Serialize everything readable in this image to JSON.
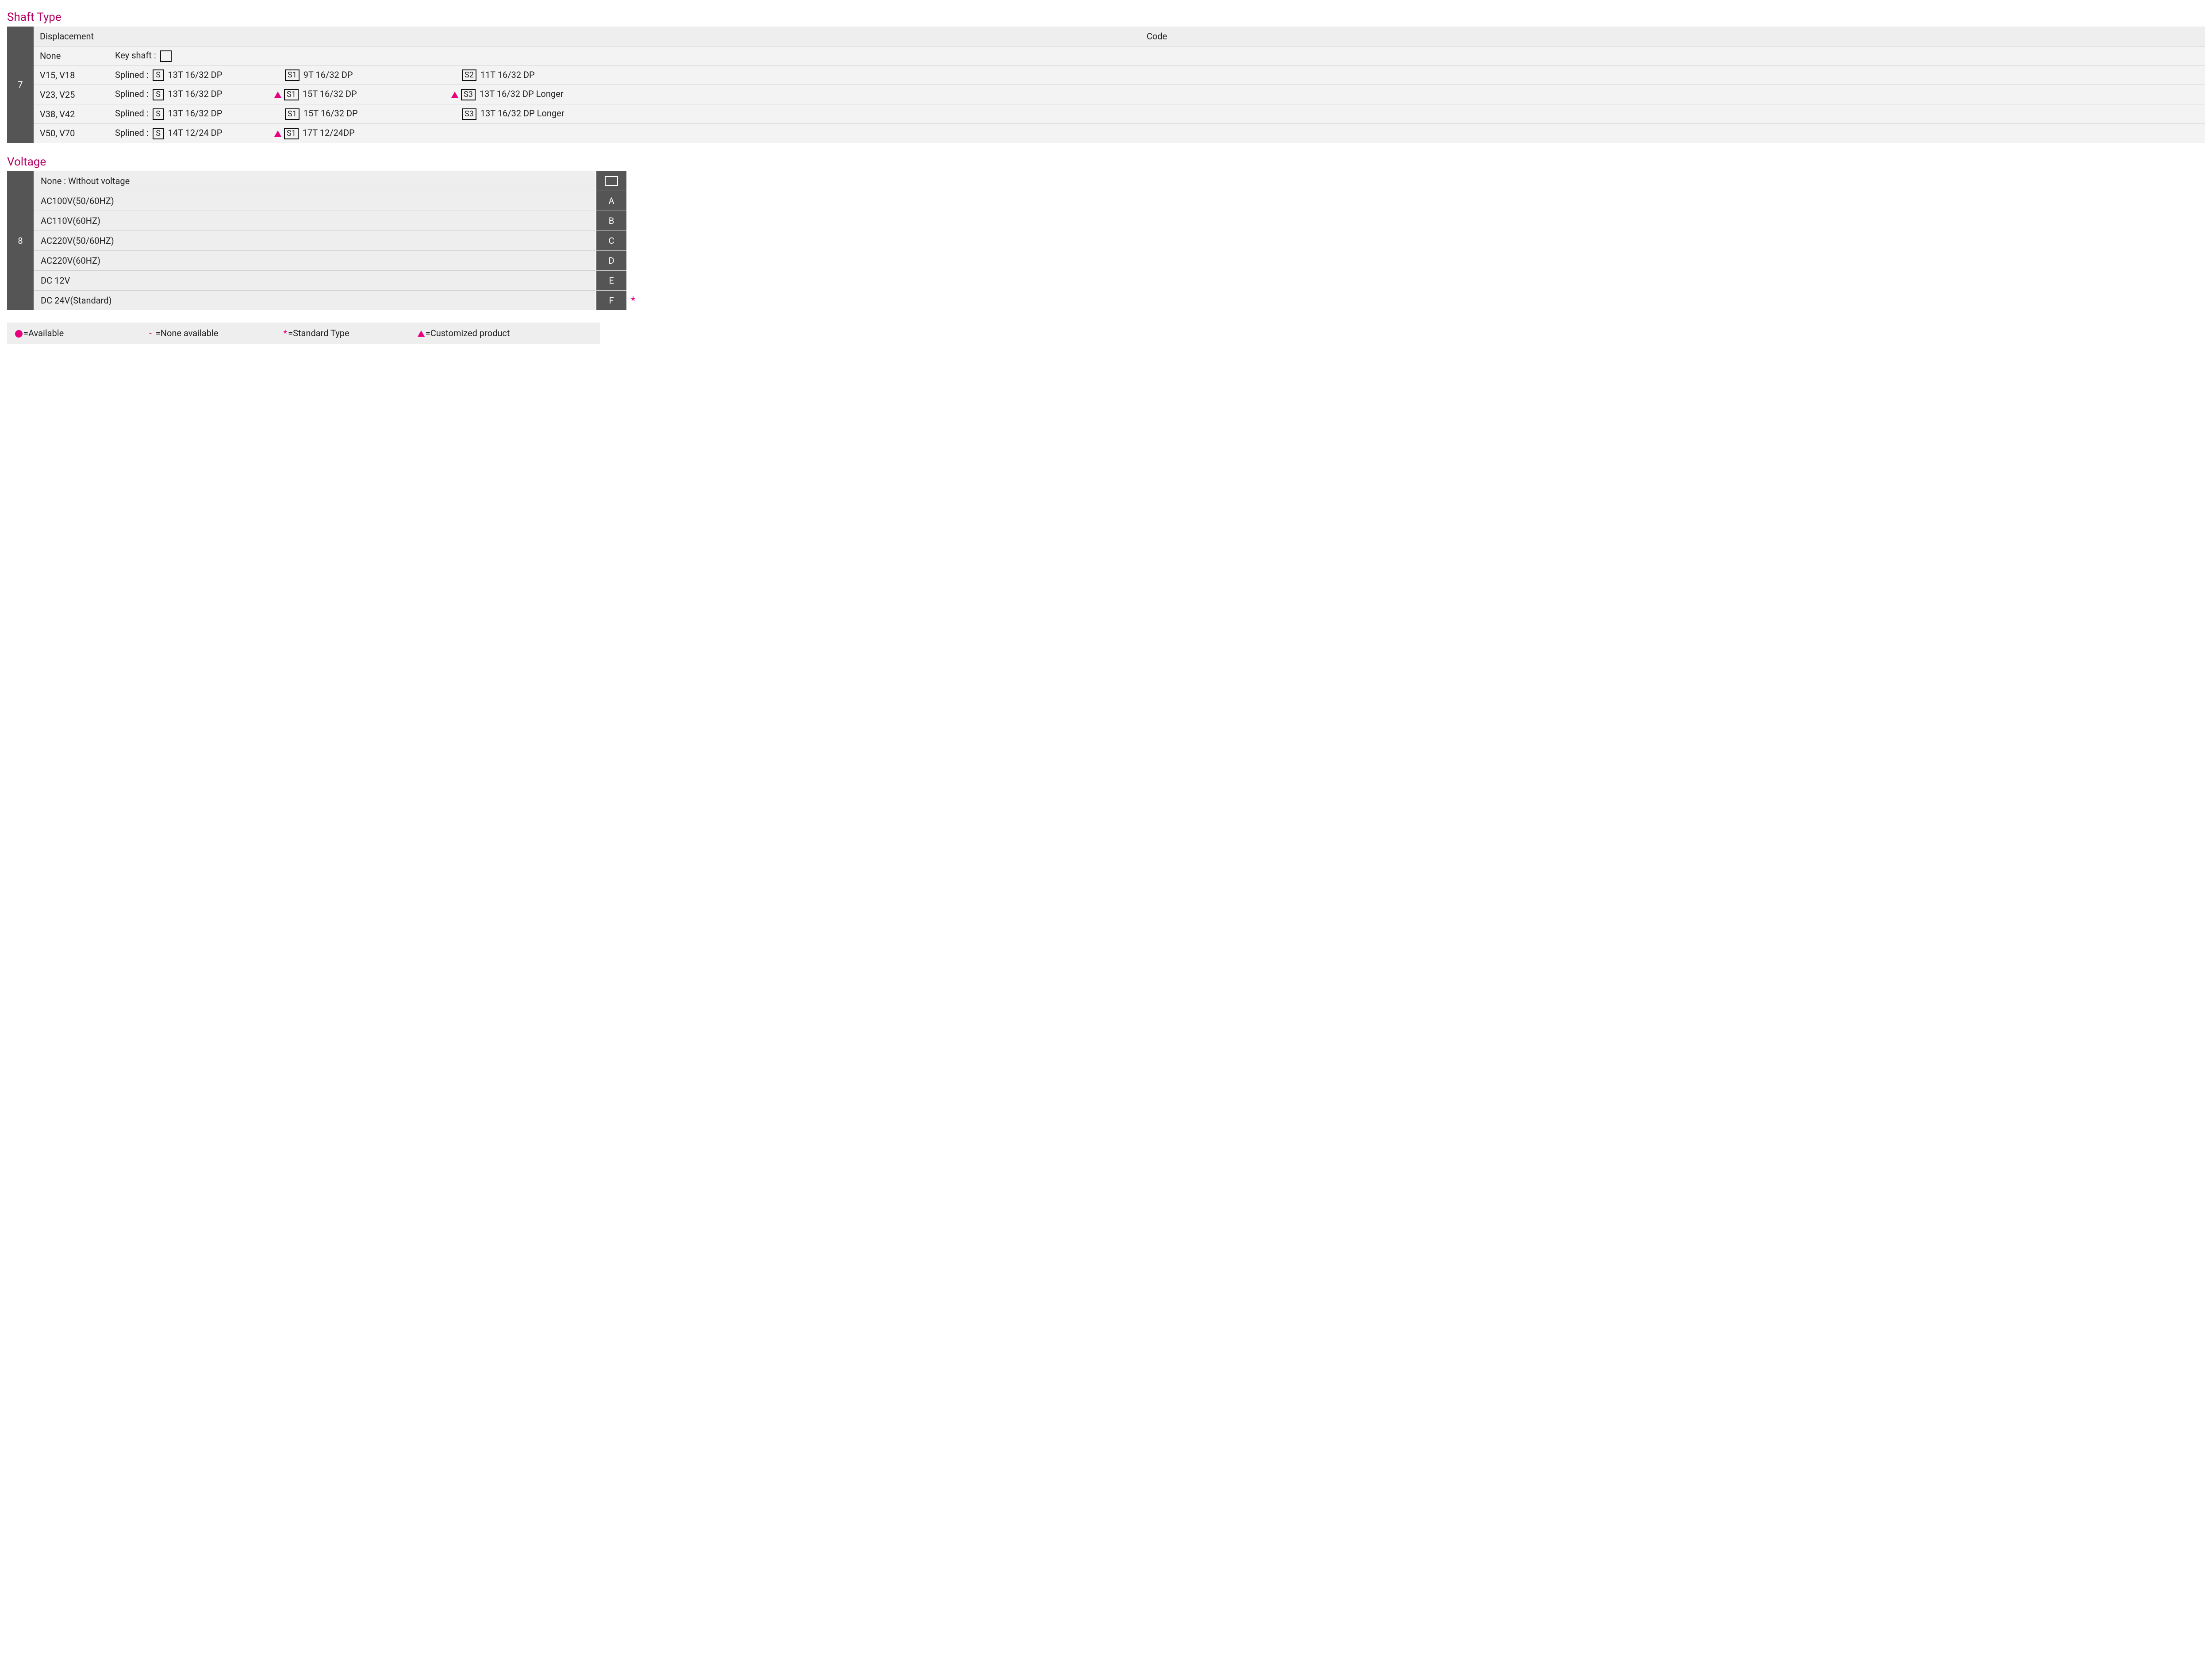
{
  "shaft": {
    "title": "Shaft Type",
    "number": "7",
    "header": {
      "displacement": "Displacement",
      "code": "Code"
    },
    "rows": [
      {
        "displacement": "None",
        "cells": [
          {
            "prefix": "Key shaft :",
            "box": "",
            "suffix": "",
            "tri": false
          }
        ]
      },
      {
        "displacement": "V15, V18",
        "cells": [
          {
            "prefix": "Splined :",
            "box": "S",
            "suffix": "13T 16/32 DP",
            "tri": false
          },
          {
            "prefix": "",
            "box": "S1",
            "suffix": "9T 16/32 DP",
            "tri": false
          },
          {
            "prefix": "",
            "box": "S2",
            "suffix": "11T 16/32 DP",
            "tri": false
          }
        ]
      },
      {
        "displacement": "V23, V25",
        "cells": [
          {
            "prefix": "Splined :",
            "box": "S",
            "suffix": "13T 16/32 DP",
            "tri": false
          },
          {
            "prefix": "",
            "box": "S1",
            "suffix": "15T 16/32 DP",
            "tri": true
          },
          {
            "prefix": "",
            "box": "S3",
            "suffix": "13T 16/32 DP Longer",
            "tri": true
          }
        ]
      },
      {
        "displacement": "V38, V42",
        "cells": [
          {
            "prefix": "Splined :",
            "box": "S",
            "suffix": "13T 16/32 DP",
            "tri": false
          },
          {
            "prefix": "",
            "box": "S1",
            "suffix": "15T 16/32 DP",
            "tri": false
          },
          {
            "prefix": "",
            "box": "S3",
            "suffix": "13T 16/32 DP Longer",
            "tri": false
          }
        ]
      },
      {
        "displacement": "V50, V70",
        "cells": [
          {
            "prefix": "Splined :",
            "box": "S",
            "suffix": "14T 12/24 DP",
            "tri": false
          },
          {
            "prefix": "",
            "box": "S1",
            "suffix": "17T 12/24DP",
            "tri": true
          }
        ]
      }
    ]
  },
  "voltage": {
    "title": "Voltage",
    "number": "8",
    "rows": [
      {
        "label": "None : Without voltage",
        "code": "",
        "star": false
      },
      {
        "label": "AC100V(50/60HZ)",
        "code": "A",
        "star": false
      },
      {
        "label": "AC110V(60HZ)",
        "code": "B",
        "star": false
      },
      {
        "label": "AC220V(50/60HZ)",
        "code": "C",
        "star": false
      },
      {
        "label": "AC220V(60HZ)",
        "code": "D",
        "star": false
      },
      {
        "label": "DC 12V",
        "code": "E",
        "star": false
      },
      {
        "label": "DC 24V(Standard)",
        "code": "F",
        "star": true
      }
    ]
  },
  "legend": {
    "available": "=Available",
    "none": " =None available",
    "standard": "=Standard Type",
    "custom": "=Customized product"
  }
}
